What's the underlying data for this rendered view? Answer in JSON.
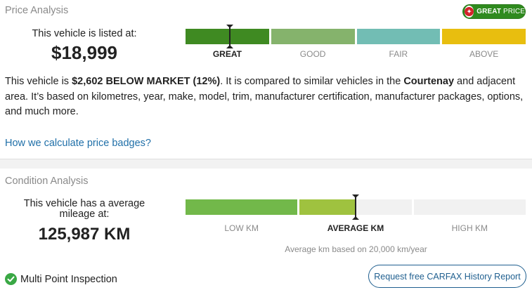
{
  "price_analysis": {
    "title": "Price Analysis",
    "badge": {
      "bold": "GREAT",
      "light": "PRICE",
      "icon": "carfax-maple-leaf-icon"
    },
    "listed_label": "This vehicle is listed at:",
    "price": "$18,999",
    "scale": [
      {
        "label": "GREAT",
        "color": "#3f8a22",
        "active": true
      },
      {
        "label": "GOOD",
        "color": "#85b36c",
        "active": false
      },
      {
        "label": "FAIR",
        "color": "#72bdb4",
        "active": false
      },
      {
        "label": "ABOVE",
        "color": "#e8be0f",
        "active": false
      }
    ],
    "marker_position": 0.13,
    "description": {
      "p1": "This vehicle is ",
      "b1": "$2,602 BELOW MARKET (12%)",
      "p2": ". It is compared to similar vehicles in the ",
      "b2": "Courtenay",
      "p3": " and adjacent area. It’s based on kilometres, year, make, model, trim, manufacturer certification, manufacturer packages, options, and much more."
    },
    "link": "How we calculate price badges?"
  },
  "condition_analysis": {
    "title": "Condition Analysis",
    "mileage_label": "This vehicle has a average mileage at:",
    "mileage": "125,987 KM",
    "scale": [
      {
        "label": "LOW KM",
        "active": false
      },
      {
        "label": "AVERAGE KM",
        "active": true
      },
      {
        "label": "HIGH KM",
        "active": false
      }
    ],
    "bar_colors": {
      "low": "#72b84a",
      "average": "#9fc23f",
      "empty": "#f1f1f1"
    },
    "fill_fraction_of_average": 0.5,
    "note": "Average km based on 20,000 km/year",
    "inspection": {
      "label": "Multi Point Inspection",
      "icon": "check-circle-icon"
    },
    "request_button": "Request free CARFAX History Report"
  }
}
